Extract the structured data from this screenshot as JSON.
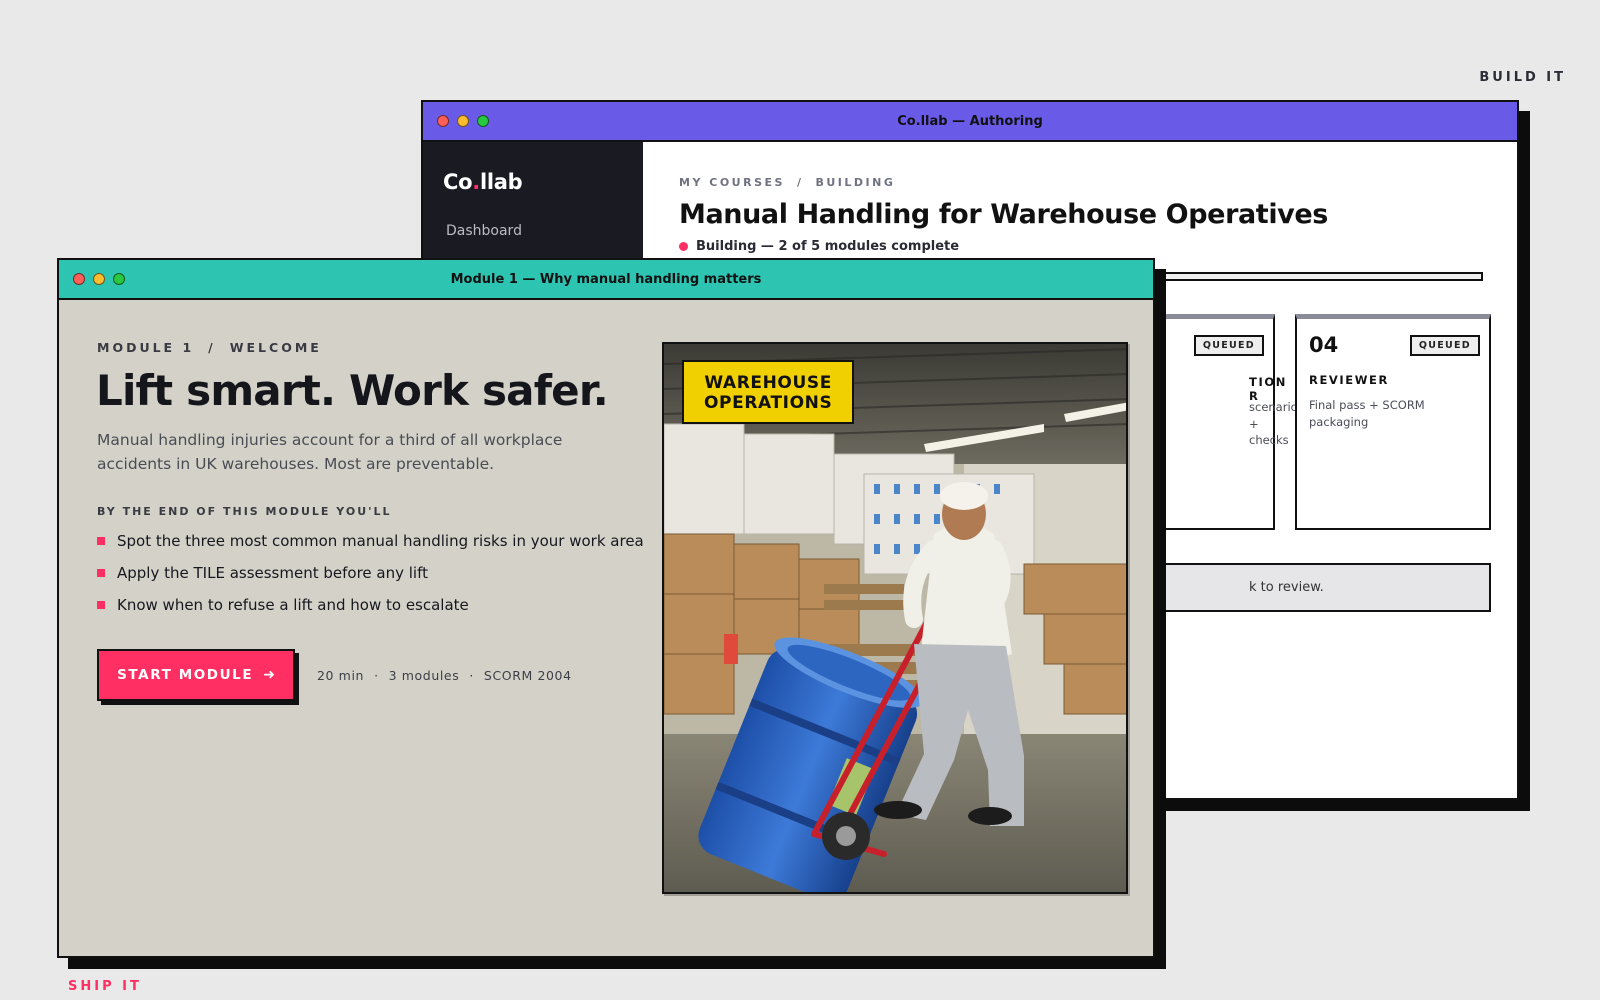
{
  "labels": {
    "build": "BUILD IT",
    "ship": "SHIP IT"
  },
  "authoring_window": {
    "title": "Co.llab — Authoring",
    "titlebar_color": "#6a5ae8",
    "logo": {
      "part1": "Co",
      "dot": ".",
      "part2": "llab"
    },
    "sidebar": {
      "items": [
        {
          "label": "Dashboard"
        }
      ]
    },
    "breadcrumb": [
      "MY COURSES",
      "/",
      "BUILDING"
    ],
    "course_title": "Manual Handling for Warehouse Operatives",
    "status": "Building — 2 of 5 modules complete",
    "progress_fraction": 0.4,
    "stages": [
      {
        "number": "",
        "status": "QUEUED",
        "name": "TION",
        "name_line2": "R",
        "description": "scenarios +",
        "description_line2": "checks"
      },
      {
        "number": "04",
        "status": "QUEUED",
        "name": "REVIEWER",
        "description": "Final pass + SCORM",
        "description_line2": "packaging"
      }
    ],
    "review_note": "k to review."
  },
  "module_window": {
    "title": "Module 1 — Why manual handling matters",
    "titlebar_color": "#2ec4b2",
    "kicker": [
      "MODULE 1",
      "/",
      "WELCOME"
    ],
    "headline": "Lift smart. Work safer.",
    "lede": "Manual handling injuries account for a third of all workplace accidents in UK warehouses. Most are preventable.",
    "objectives_heading": "BY THE END OF THIS MODULE YOU'LL",
    "objectives": [
      "Spot the three most common manual handling risks in your work area",
      "Apply the TILE assessment before any lift",
      "Know when to refuse a lift and how to escalate"
    ],
    "start_button": {
      "label": "START MODULE",
      "icon": "arrow-right-icon",
      "glyph": "➜"
    },
    "meta": [
      "20 min",
      "·",
      "3 modules",
      "·",
      "SCORM 2004"
    ],
    "photo_tag": {
      "line1": "WAREHOUSE",
      "line2": "OPERATIONS"
    }
  },
  "colors": {
    "accent": "#ff2e63",
    "tag": "#f1d000",
    "purple": "#6a5ae8",
    "teal": "#2ec4b2"
  }
}
